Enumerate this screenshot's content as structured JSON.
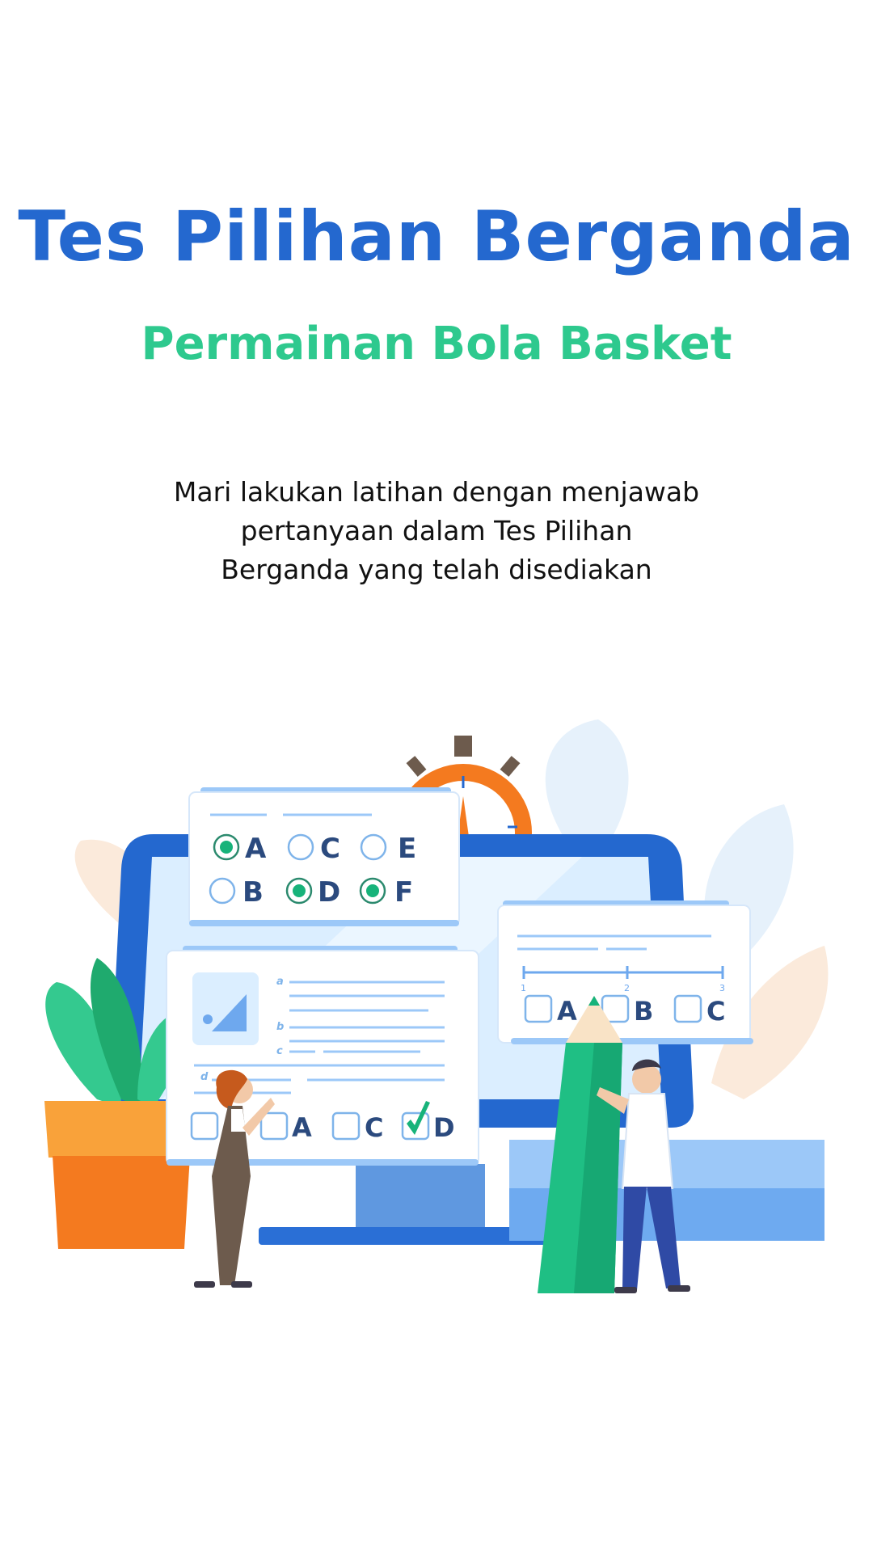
{
  "header": {
    "title": "Tes Pilihan Berganda",
    "subtitle": "Permainan Bola Basket"
  },
  "intro": {
    "lines": [
      "Mari lakukan latihan dengan menjawab",
      "pertanyaan dalam Tes Pilihan",
      "Berganda yang telah disediakan"
    ]
  },
  "illustration": {
    "radio_card": {
      "options": [
        "A",
        "C",
        "E",
        "B",
        "D",
        "F"
      ],
      "selected": [
        "A",
        "D",
        "F"
      ]
    },
    "text_card": {
      "row_labels": [
        "a",
        "b",
        "c",
        "d"
      ],
      "options": [
        "A",
        "C",
        "D"
      ],
      "checked": "D"
    },
    "right_card": {
      "scale_labels": [
        "1",
        "2",
        "3"
      ],
      "options": [
        "A",
        "B",
        "C"
      ]
    },
    "icons": [
      "stopwatch-icon",
      "pencil-icon",
      "checkmark-icon",
      "plant-icon"
    ],
    "colors": {
      "primary_blue": "#2468cf",
      "accent_green": "#2ec98e",
      "orange": "#f47a1f",
      "answer_text": "#2b4a7e"
    }
  }
}
